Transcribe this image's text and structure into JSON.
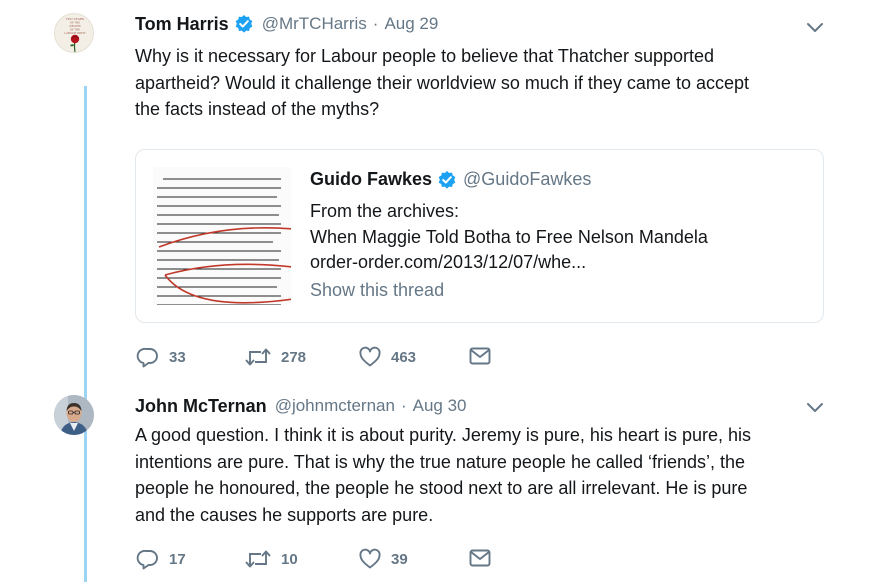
{
  "tweets": [
    {
      "name": "Tom Harris",
      "handle": "@MrTCHarris",
      "separator": "·",
      "date": "Aug 29",
      "text_lines": [
        "Why is it necessary for Labour people to believe that Thatcher supported",
        "apartheid? Would it challenge their worldview so much if they came to accept",
        "the facts instead of the myths?"
      ],
      "avatar_book": {
        "line1": "TEN YEARS",
        "line2": "OF THE",
        "line3": "DEATH",
        "line4": "OF THE",
        "line5": "LABOUR PARTY"
      },
      "quote": {
        "name": "Guido Fawkes",
        "handle": "@GuidoFawkes",
        "line1": "From the archives:",
        "line2": "When Maggie Told Botha to Free Nelson Mandela",
        "line3": "order-order.com/2013/12/07/whe...",
        "show_thread": "Show this thread"
      },
      "actions": {
        "replies": "33",
        "retweets": "278",
        "likes": "463"
      }
    },
    {
      "name": "John McTernan",
      "handle": "@johnmcternan",
      "separator": "·",
      "date": "Aug 30",
      "text_lines": [
        "A good question. I think it is about purity. Jeremy is pure, his heart is pure, his",
        "intentions are pure. That is why the true nature people he called ‘friends’, the",
        "people he honoured, the people he stood next to are all irrelevant. He is pure",
        "and the causes he supports are pure."
      ],
      "actions": {
        "replies": "17",
        "retweets": "10",
        "likes": "39"
      }
    }
  ],
  "colors": {
    "verified": "#1da1f2",
    "thread": "#9dd3f5",
    "secondary": "#657786",
    "rose": "#b3121c"
  },
  "icons": [
    "verified-icon",
    "chevron-down-icon",
    "reply-icon",
    "retweet-icon",
    "like-icon",
    "message-icon"
  ]
}
